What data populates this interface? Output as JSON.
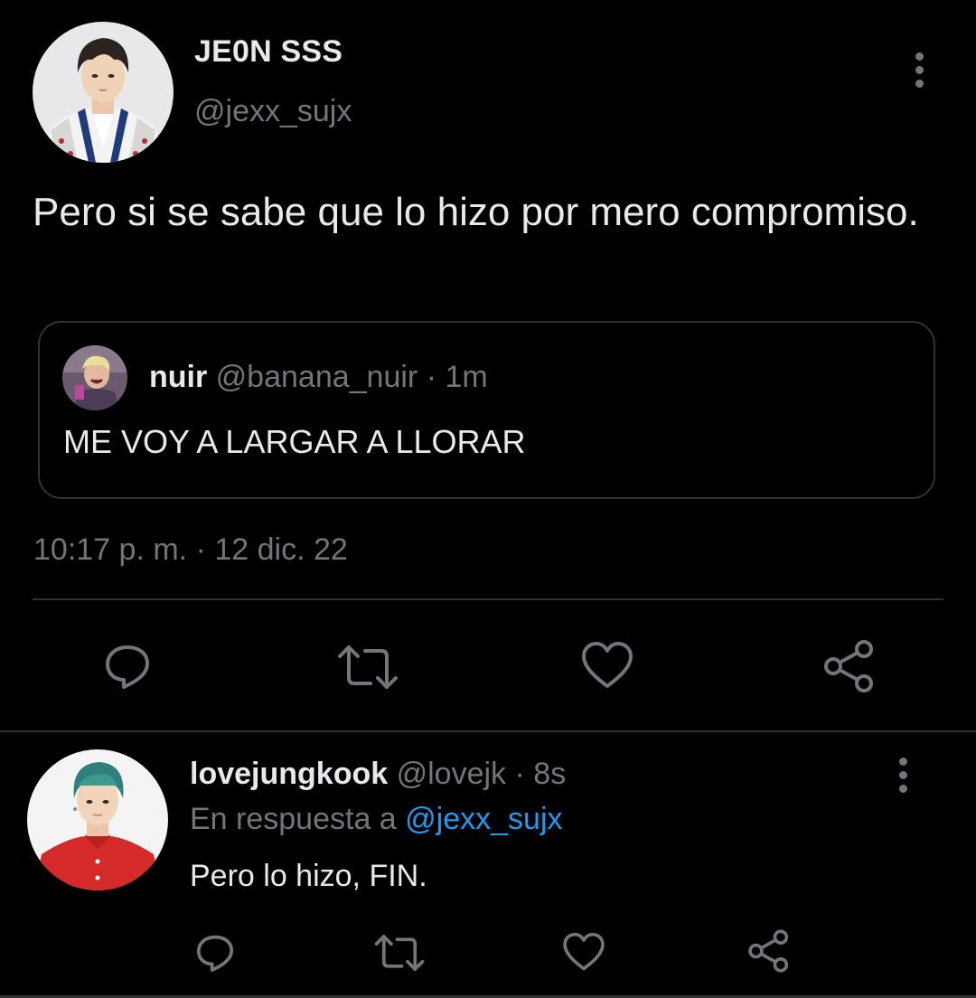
{
  "main_tweet": {
    "display_name": "JE0N SSS",
    "handle": "@jexx_sujx",
    "text": "Pero si se sabe que lo hizo por mero compromiso.",
    "timestamp_time": "10:17 p. m.",
    "timestamp_sep": "·",
    "timestamp_date": "12 dic. 22",
    "more_icon": "more-vertical-icon"
  },
  "quoted_tweet": {
    "display_name": "nuir",
    "handle": "@banana_nuir",
    "separator": "·",
    "time": "1m",
    "text": "ME VOY A LARGAR A LLORAR"
  },
  "actions": {
    "icons": [
      "reply-icon",
      "retweet-icon",
      "like-icon",
      "share-icon"
    ]
  },
  "reply_tweet": {
    "display_name": "lovejungkook",
    "handle": "@lovejk",
    "separator": "·",
    "time": "8s",
    "reply_context_prefix": "En respuesta a",
    "reply_context_mention": "@jexx_sujx",
    "text": "Pero lo hizo, FIN."
  },
  "colors": {
    "background": "#000000",
    "primary_text": "#e7e9ea",
    "secondary_text": "#71767b",
    "link": "#1d9bf0",
    "border": "#2f3336"
  }
}
